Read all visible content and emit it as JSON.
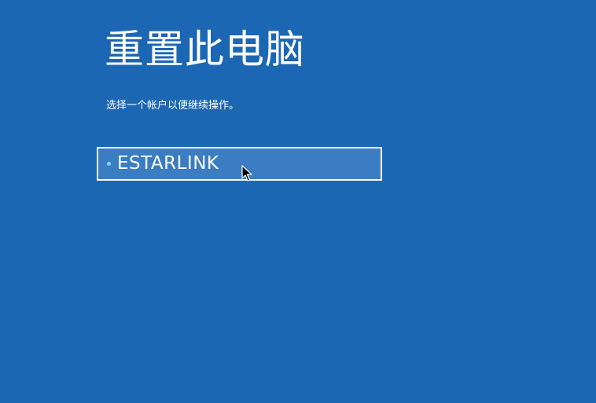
{
  "header": {
    "title": "重置此电脑",
    "subtitle": "选择一个帐户以便继续操作。"
  },
  "accounts": [
    {
      "label": "ESTARLINK",
      "selected": true
    }
  ],
  "colors": {
    "background": "#1c67b4",
    "selected_item_background": "#3b7dc2",
    "bullet": "#8fd0f5",
    "text": "#ffffff"
  },
  "icons": {
    "bullet": "dot-icon",
    "pointer": "mouse-cursor-icon"
  }
}
